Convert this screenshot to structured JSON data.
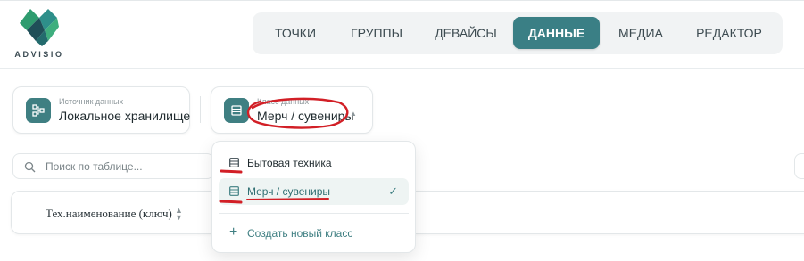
{
  "logo": {
    "text": "ADVISIO",
    "icon": "advisio-logo"
  },
  "nav": {
    "items": [
      {
        "label": "ТОЧКИ",
        "active": false
      },
      {
        "label": "ГРУППЫ",
        "active": false
      },
      {
        "label": "ДЕВАЙСЫ",
        "active": false
      },
      {
        "label": "ДАННЫЕ",
        "active": true
      },
      {
        "label": "МЕДИА",
        "active": false
      },
      {
        "label": "РЕДАКТОР",
        "active": false
      }
    ]
  },
  "data_source": {
    "caption": "Источник данных",
    "value": "Локальное хранилище",
    "icon": "data-source-icon"
  },
  "data_class": {
    "caption": "Класс данных",
    "value": "Мерч / сувениры",
    "icon": "table-icon"
  },
  "search": {
    "placeholder": "Поиск по таблице...",
    "value": "",
    "icon": "search-icon"
  },
  "table": {
    "columns": [
      {
        "label": "Тех.наименование (ключ)",
        "sortable": true
      }
    ]
  },
  "class_dropdown": {
    "items": [
      {
        "label": "Бытовая техника",
        "selected": false,
        "icon": "table-icon"
      },
      {
        "label": "Мерч / сувениры",
        "selected": true,
        "icon": "table-icon"
      }
    ],
    "create_label": "Создать новый класс",
    "check_icon": "check-icon",
    "plus_icon": "plus-icon"
  },
  "colors": {
    "accent": "#3a7f85",
    "annotation": "#d21f26"
  }
}
